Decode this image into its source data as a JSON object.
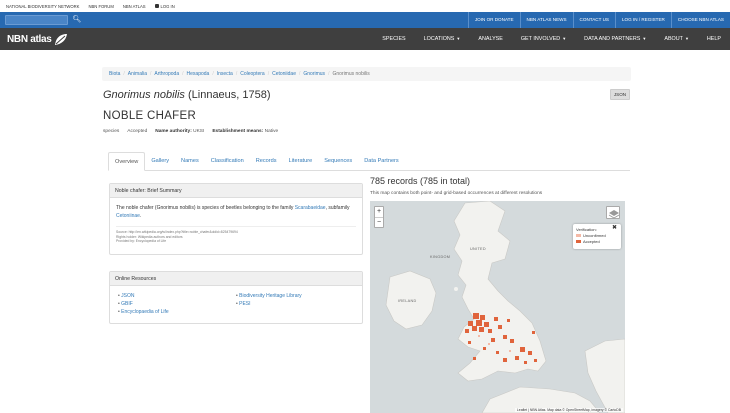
{
  "top_strip": {
    "links": [
      "NATIONAL BIODIVERSITY NETWORK",
      "NBN FORUM",
      "NBN ATLAS",
      "LOG IN"
    ]
  },
  "blue_bar": {
    "links": [
      "JOIN OR DONATE",
      "NBN ATLAS NEWS",
      "CONTACT US",
      "LOG IN / REGISTER",
      "CHOOSE NBN ATLAS"
    ]
  },
  "logo": {
    "text": "NBN atlas"
  },
  "nav": {
    "items": [
      {
        "label": "SPECIES",
        "caret": false
      },
      {
        "label": "LOCATIONS",
        "caret": true
      },
      {
        "label": "ANALYSE",
        "caret": false
      },
      {
        "label": "GET INVOLVED",
        "caret": true
      },
      {
        "label": "DATA AND PARTNERS",
        "caret": true
      },
      {
        "label": "ABOUT",
        "caret": true
      },
      {
        "label": "HELP",
        "caret": false
      }
    ]
  },
  "breadcrumb": {
    "items": [
      "Biota",
      "Animalia",
      "Arthropoda",
      "Hexapoda",
      "Insecta",
      "Coleoptera",
      "Cetoniidae",
      "Gnorimus"
    ],
    "current": "Gnorimus nobilis"
  },
  "taxon": {
    "scientific_name": "Gnorimus nobilis",
    "authority": "(Linnaeus, 1758)",
    "common_name": "NOBLE CHAFER",
    "rank": "species",
    "status": "Accepted",
    "name_authority_label": "Name authority:",
    "name_authority": "UKSI",
    "establishment_label": "Establishment means:",
    "establishment": "Native"
  },
  "json_button": "JSON",
  "tabs": [
    "Overview",
    "Gallery",
    "Names",
    "Classification",
    "Records",
    "Literature",
    "Sequences",
    "Data Partners"
  ],
  "summary": {
    "heading": "Noble chafer: Brief Summary",
    "text_1": "The noble chafer (Gnorimus nobilis) is species of beetles belonging to the family ",
    "family_link": "Scarabaeidae",
    "text_2": ", subfamily ",
    "subfamily_link": "Cetoniinae",
    "text_3": ".",
    "source": "Source: http://en.wikipedia.org/w/index.php?title=noble_chafer&oldid=825479694",
    "rights": "Rights holder: Wikipedia authors and editors",
    "provided": "Provided by: Encyclopedia of Life"
  },
  "resources": {
    "heading": "Online Resources",
    "col1": [
      "JSON",
      "GBIF",
      "Encyclopaedia of Life"
    ],
    "col2": [
      "Biodiversity Heritage Library",
      "PESI"
    ]
  },
  "records": {
    "title": "785 records (785 in total)",
    "subtitle": "This map contains both point- and grid-based occurrences at different resolutions"
  },
  "map": {
    "zoom_in": "+",
    "zoom_out": "−",
    "legend_title": "Verification:",
    "legend_items": [
      {
        "label": "Unconfirmed",
        "color": "#f4b9a6"
      },
      {
        "label": "Accepted",
        "color": "#e0643c"
      }
    ],
    "legend_close": "✖",
    "labels": [
      "KINGDOM",
      "IRELAND",
      "UNITED"
    ],
    "attribution": "Leaflet | NBN Atlas. Map data © OpenStreetMap, imagery © CartoDB"
  }
}
